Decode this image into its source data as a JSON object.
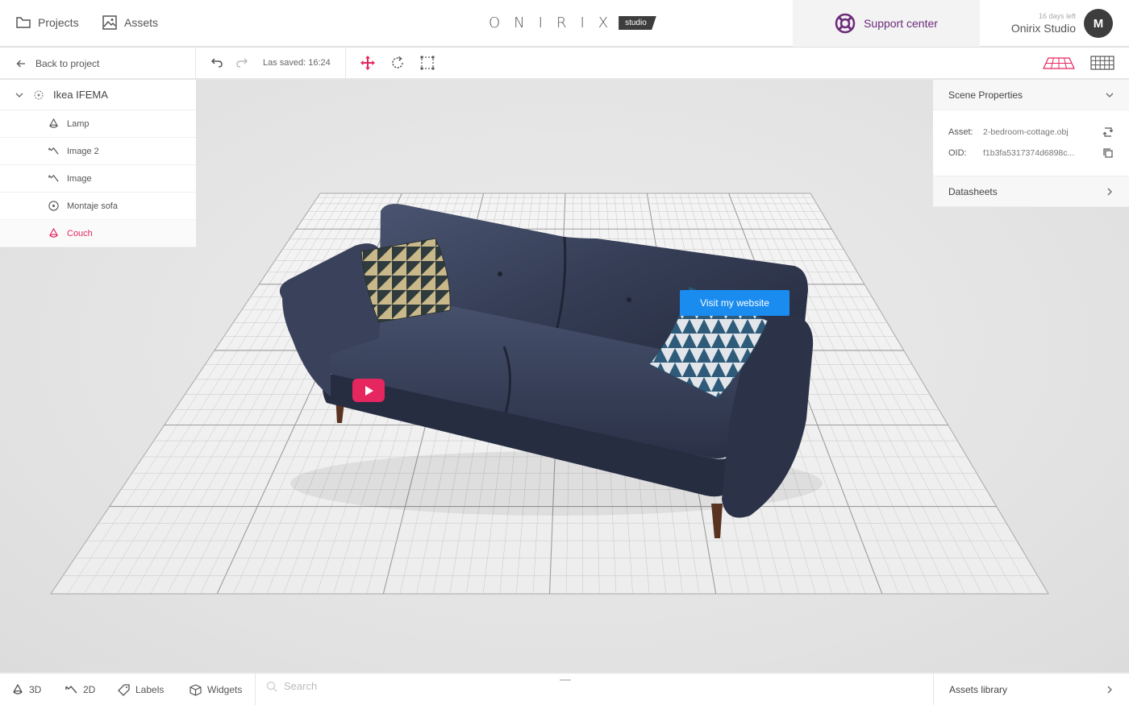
{
  "header": {
    "nav": [
      {
        "label": "Projects",
        "icon": "folder-icon"
      },
      {
        "label": "Assets",
        "icon": "image-icon"
      }
    ],
    "logo": {
      "text": "ONIRIX",
      "badge": "studio"
    },
    "support": {
      "label": "Support center",
      "color": "#6b2a7a"
    },
    "user": {
      "days_left": "16 days left",
      "name": "Onirix Studio",
      "initial": "M"
    }
  },
  "toolbar": {
    "back_label": "Back to project",
    "last_saved": "Las saved: 16:24",
    "accent": "#e5265f"
  },
  "tree": {
    "root": "Ikea IFEMA",
    "items": [
      {
        "label": "Lamp",
        "icon": "cone-icon"
      },
      {
        "label": "Image 2",
        "icon": "image-2d-icon"
      },
      {
        "label": "Image",
        "icon": "image-2d-icon"
      },
      {
        "label": "Montaje sofa",
        "icon": "play-circle-icon"
      },
      {
        "label": "Couch",
        "icon": "cone-icon",
        "active": true
      }
    ]
  },
  "properties": {
    "title": "Scene Properties",
    "asset_key": "Asset:",
    "asset_value": "2-bedroom-cottage.obj",
    "oid_key": "OID:",
    "oid_value": "f1b3fa5317374d6898c...",
    "datasheets": "Datasheets"
  },
  "viewport": {
    "visit_button": "Visit my website",
    "button_color": "#1a8cf0"
  },
  "bottombar": {
    "tabs": [
      {
        "label": "3D",
        "icon": "cone-icon"
      },
      {
        "label": "2D",
        "icon": "image-2d-icon"
      },
      {
        "label": "Labels",
        "icon": "tag-icon"
      },
      {
        "label": "Widgets",
        "icon": "cube-icon"
      }
    ],
    "search_placeholder": "Search",
    "assets_library": "Assets library"
  }
}
